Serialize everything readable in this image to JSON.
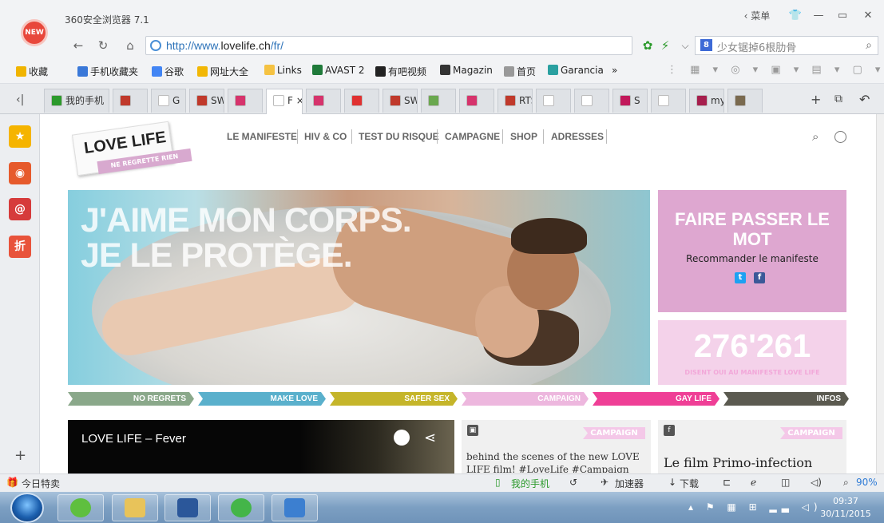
{
  "app": {
    "title": "360安全浏览器 7.1",
    "badge": "NEW",
    "menu_label": "菜单"
  },
  "navigation": {
    "url_prefix": "http://www.",
    "url_host": "lovelife.ch",
    "url_path": "/fr/",
    "search_text": "少女锯掉6根肋骨"
  },
  "favorites": [
    {
      "label": "收藏",
      "color": "#f0b400"
    },
    {
      "label": "手机收藏夹",
      "color": "#3a78d8"
    },
    {
      "label": "谷歌",
      "color": "#4285f4"
    },
    {
      "label": "网址大全",
      "color": "#f2b705"
    },
    {
      "label": "Links",
      "color": "#f5c242"
    },
    {
      "label": "AVAST 2",
      "color": "#1f7a3a"
    },
    {
      "label": "有吧视频",
      "color": "#222222"
    },
    {
      "label": "Magazin",
      "color": "#333333"
    },
    {
      "label": "首页",
      "color": "#999999"
    },
    {
      "label": "Garancia",
      "color": "#2aa0a0"
    },
    {
      "label": "»",
      "color": ""
    }
  ],
  "tabs": [
    {
      "label": "我的手机",
      "color": "#2c9a2c"
    },
    {
      "label": "",
      "color": "#c0392b"
    },
    {
      "label": "G",
      "color": "#ffffff"
    },
    {
      "label": "SWI",
      "color": "#c0392b"
    },
    {
      "label": "",
      "color": "#d6336c"
    },
    {
      "label": "F ×",
      "color": "#ffffff"
    },
    {
      "label": "",
      "color": "#d6336c"
    },
    {
      "label": "",
      "color": "#e03131"
    },
    {
      "label": "SWI",
      "color": "#c0392b"
    },
    {
      "label": "",
      "color": "#6aa84f"
    },
    {
      "label": "",
      "color": "#d6336c"
    },
    {
      "label": "RTS",
      "color": "#c0392b"
    },
    {
      "label": "",
      "color": "#ffffff"
    },
    {
      "label": "",
      "color": "#ffffff"
    },
    {
      "label": "S",
      "color": "#c2185b"
    },
    {
      "label": "",
      "color": "#ffffff"
    },
    {
      "label": "my",
      "color": "#a61e4d"
    },
    {
      "label": "",
      "color": "#7a6a4f"
    }
  ],
  "sidebar_icons": [
    {
      "name": "favorite-star-icon",
      "glyph": "★",
      "color": "#f5b400"
    },
    {
      "name": "weibo-icon",
      "glyph": "◉",
      "color": "#e65a2c"
    },
    {
      "name": "mail-icon",
      "glyph": "@",
      "color": "#d63b3b"
    },
    {
      "name": "discount-icon",
      "glyph": "折",
      "color": "#e8533b"
    }
  ],
  "site": {
    "logo_text": "LOVE LIFE",
    "logo_tagline": "NE REGRETTE RIEN",
    "menu": [
      "LE MANIFESTE",
      "HIV & CO",
      "TEST DU RISQUE",
      "CAMPAGNE",
      "SHOP",
      "ADRESSES"
    ],
    "hero_title": "J'AIME MON CORPS.\nJE LE PROTÈGE.",
    "share_title": "FAIRE PASSER LE MOT",
    "share_sub": "Recommander le manifeste",
    "counter": "276'261",
    "counter_sub": "DISENT OUI AU MANIFESTE LOVE LIFE",
    "categories": [
      {
        "label": "NO REGRETS",
        "color": "#8aa88a"
      },
      {
        "label": "MAKE LOVE",
        "color": "#5ab0cc"
      },
      {
        "label": "SAFER SEX",
        "color": "#c5b52a"
      },
      {
        "label": "CAMPAIGN",
        "color": "#edb7de"
      },
      {
        "label": "GAY LIFE",
        "color": "#ef3f96"
      },
      {
        "label": "INFOS",
        "color": "#5b5a50"
      }
    ],
    "video_title": "LOVE LIFE – Fever",
    "card1_tag": "CAMPAIGN",
    "card1_text": "behind the scenes of the new LOVE LIFE film! #LoveLife #Campaign",
    "card2_tag": "CAMPAIGN",
    "card2_text": "Le film Primo-infection"
  },
  "statusbar": {
    "left": "今日特卖",
    "phone": "我的手机",
    "accelerator": "加速器",
    "download": "下载",
    "zoom": "90%"
  },
  "taskbar": {
    "time": "09:37",
    "date": "30/11/2015"
  }
}
